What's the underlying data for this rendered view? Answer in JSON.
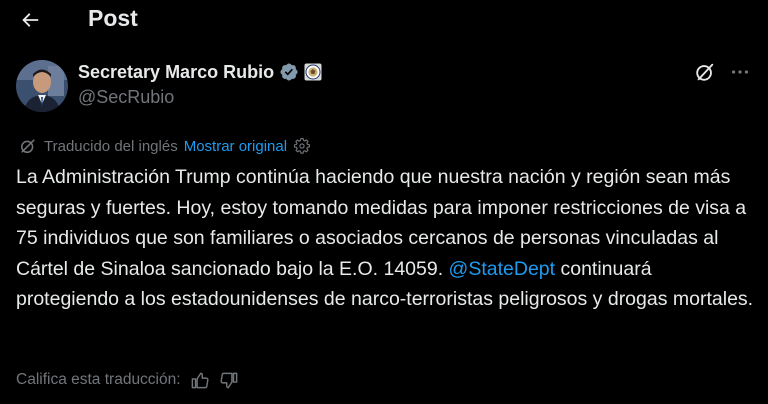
{
  "header": {
    "title": "Post",
    "back_icon": "arrow-left-icon"
  },
  "author": {
    "name": "Secretary Marco Rubio",
    "handle": "@SecRubio",
    "verified_color": "#829aab",
    "affiliate_badge": "state-department-seal-icon"
  },
  "translation": {
    "label": "Traducido del inglés",
    "show_original": "Mostrar original"
  },
  "post": {
    "text_part1": "La Administración Trump continúa haciendo que nuestra nación y región sean más seguras y fuertes. Hoy, estoy tomando medidas para imponer restricciones de visa a 75 individuos que son familiares o asociados cercanos de personas vinculadas al Cártel de Sinaloa sancionado bajo la E.O. 14059. ",
    "mention": "@StateDept",
    "text_part2": " continuará protegiendo a los estadounidenses de narco-terroristas peligrosos y drogas mortales."
  },
  "rating": {
    "label": "Califica esta traducción:"
  },
  "colors": {
    "background": "#000000",
    "text": "#e7e9ea",
    "secondary": "#71767b",
    "link": "#1d9bf0"
  }
}
